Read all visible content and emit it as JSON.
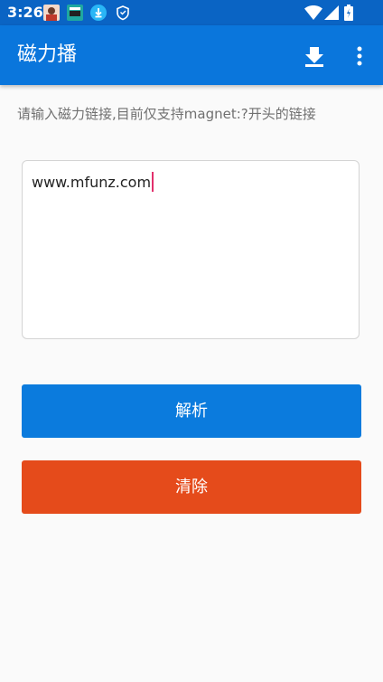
{
  "status_bar": {
    "time": "3:26",
    "notification_icons": [
      "avatar-icon",
      "game-icon",
      "download-icon",
      "shield-icon"
    ],
    "right_icons": [
      "wifi-icon",
      "signal-icon",
      "battery-icon"
    ]
  },
  "app_bar": {
    "title": "磁力播",
    "actions": [
      "download-icon",
      "more-vertical-icon"
    ]
  },
  "instruction": "请输入磁力链接,目前仅支持magnet:?开头的链接",
  "input": {
    "value": "www.mfunz.com"
  },
  "buttons": {
    "parse_label": "解析",
    "clear_label": "清除"
  },
  "colors": {
    "status_bar": "#0a64c4",
    "app_bar": "#0a76dc",
    "parse_button": "#0b7bdd",
    "clear_button": "#e54b1b",
    "caret": "#e2306c"
  }
}
